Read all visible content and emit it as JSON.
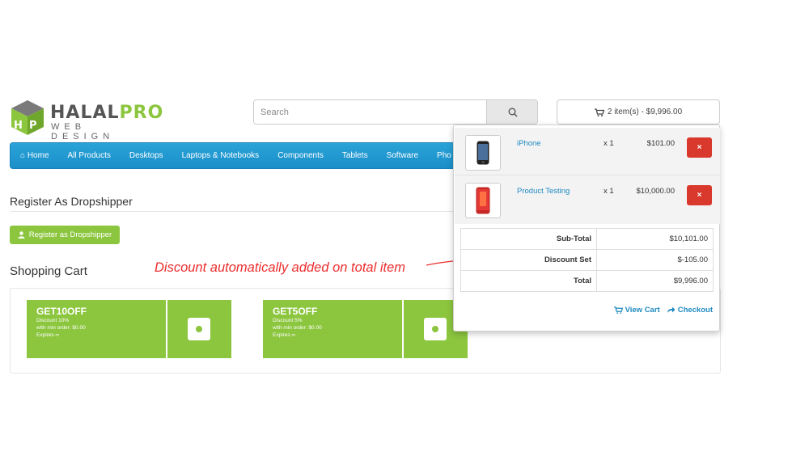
{
  "brand": {
    "name_main": "HALAL",
    "name_accent": "PRO",
    "tagline": "WEB DESIGN",
    "color": "#8cc63f"
  },
  "search": {
    "placeholder": "Search",
    "icon": "search-icon"
  },
  "cart_summary": {
    "label": "2 item(s) - $9,996.00",
    "icon": "cart-icon"
  },
  "nav": {
    "items": [
      {
        "label": "Home",
        "icon": "home-icon"
      },
      {
        "label": "All Products"
      },
      {
        "label": "Desktops"
      },
      {
        "label": "Laptops & Notebooks"
      },
      {
        "label": "Components"
      },
      {
        "label": "Tablets"
      },
      {
        "label": "Software"
      },
      {
        "label": "Pho"
      }
    ],
    "color": "#229ad2"
  },
  "page": {
    "title": "Register As Dropshipper",
    "register_button": "Register as Dropshipper",
    "cart_title": "Shopping Cart",
    "annotation": "Discount automatically added on total item"
  },
  "coupons": [
    {
      "code": "GET10OFF",
      "discount": "Discount 10%",
      "min_order": "with min order: $0.00",
      "expires": "Expires ∞"
    },
    {
      "code": "GET5OFF",
      "discount": "Discount 5%",
      "min_order": "with min order: $0.00",
      "expires": "Expires ∞"
    }
  ],
  "dropdown": {
    "items": [
      {
        "name": "iPhone",
        "qty": "x 1",
        "price": "$101.00",
        "remove": "×"
      },
      {
        "name": "Product Testing",
        "qty": "x 1",
        "price": "$10,000.00",
        "remove": "×"
      }
    ],
    "totals": [
      {
        "label": "Sub-Total",
        "value": "$10,101.00"
      },
      {
        "label": "Discount Set",
        "value": "$-105.00"
      },
      {
        "label": "Total",
        "value": "$9,996.00"
      }
    ],
    "view_cart": "View Cart",
    "checkout": "Checkout"
  }
}
